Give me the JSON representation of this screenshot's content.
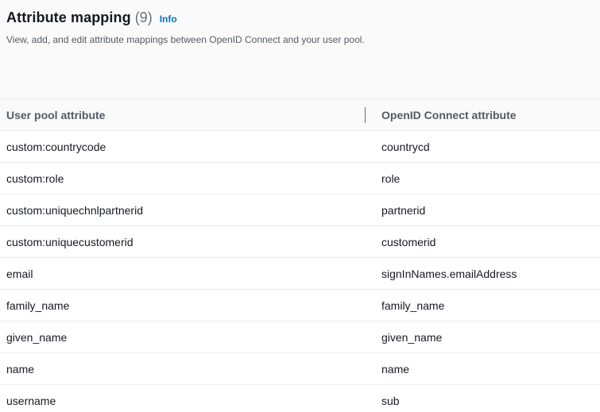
{
  "header": {
    "title": "Attribute mapping",
    "count": "(9)",
    "info": "Info",
    "description": "View, add, and edit attribute mappings between OpenID Connect and your user pool."
  },
  "table": {
    "columns": [
      "User pool attribute",
      "OpenID Connect attribute"
    ],
    "rows": [
      {
        "user_pool": "custom:countrycode",
        "oidc": "countrycd"
      },
      {
        "user_pool": "custom:role",
        "oidc": "role"
      },
      {
        "user_pool": "custom:uniquechnlpartnerid",
        "oidc": "partnerid"
      },
      {
        "user_pool": "custom:uniquecustomerid",
        "oidc": "customerid"
      },
      {
        "user_pool": "email",
        "oidc": "signInNames.emailAddress"
      },
      {
        "user_pool": "family_name",
        "oidc": "family_name"
      },
      {
        "user_pool": "given_name",
        "oidc": "given_name"
      },
      {
        "user_pool": "name",
        "oidc": "name"
      },
      {
        "user_pool": "username",
        "oidc": "sub"
      }
    ]
  },
  "colors": {
    "link": "#0073bb",
    "text": "#16191f",
    "muted": "#545b64",
    "border": "#eaeded"
  }
}
